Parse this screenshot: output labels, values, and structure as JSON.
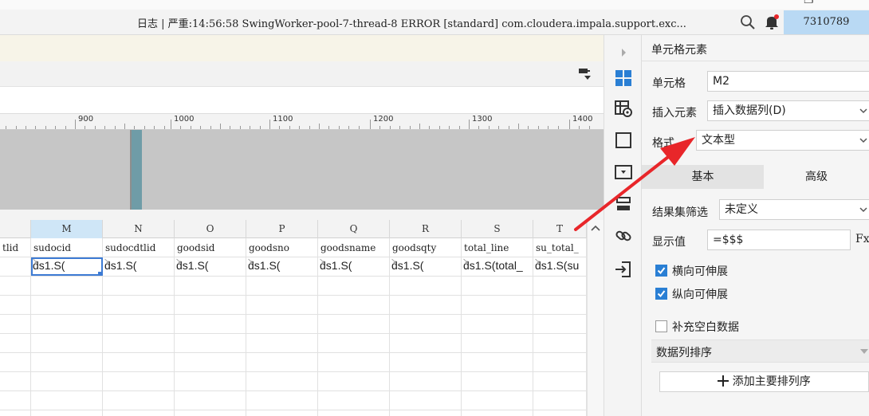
{
  "topbar": {
    "log_text": "日志 | 严重:14:56:58 SwingWorker-pool-7-thread-8 ERROR [standard] com.cloudera.impala.support.exc...",
    "user_id": "7310789",
    "restore_glyph": "❐"
  },
  "ruler": {
    "labels": [
      "900",
      "1000",
      "1100",
      "1200",
      "1300",
      "1400"
    ]
  },
  "grid": {
    "columns": [
      {
        "id": "",
        "field": "tlid",
        "expr": ""
      },
      {
        "id": "M",
        "field": "sudocid",
        "expr": "ds1.S("
      },
      {
        "id": "N",
        "field": "sudocdtlid",
        "expr": "ds1.S("
      },
      {
        "id": "O",
        "field": "goodsid",
        "expr": "ds1.S("
      },
      {
        "id": "P",
        "field": "goodsno",
        "expr": "ds1.S("
      },
      {
        "id": "Q",
        "field": "goodsname",
        "expr": "ds1.S("
      },
      {
        "id": "R",
        "field": "goodsqty",
        "expr": "ds1.S("
      },
      {
        "id": "S",
        "field": "total_line",
        "expr": "ds1.S(total_"
      },
      {
        "id": "T",
        "field": "su_total_",
        "expr": "ds1.S(su"
      }
    ],
    "selected_column": "M"
  },
  "panel": {
    "title": "单元格元素",
    "cell_label": "单元格",
    "cell_value": "M2",
    "insert_label": "插入元素",
    "insert_value": "插入数据列(D)",
    "format_label": "格式",
    "format_value": "文本型",
    "tab_basic": "基本",
    "tab_advanced": "高级",
    "filter_label": "结果集筛选",
    "filter_value": "未定义",
    "display_label": "显示值",
    "display_value": "=$$$",
    "display_fx": "Fx",
    "horizontal_expand": "横向可伸展",
    "horizontal_expand_checked": true,
    "vertical_expand": "纵向可伸展",
    "vertical_expand_checked": true,
    "fill_blank": "补充空白数据",
    "fill_blank_checked": false,
    "sort_label": "数据列排序",
    "add_sort_button": "添加主要排列序"
  },
  "icons": {
    "search": "search-icon",
    "bell": "bell-icon",
    "format_painter": "format-painter-icon",
    "side": [
      "collapse-arrow-icon",
      "cell-element-icon",
      "cell-attribute-icon",
      "widget-icon",
      "dropdown-widget-icon",
      "condition-icon",
      "hyperlink-icon",
      "import-icon"
    ]
  },
  "colors": {
    "selected_header": "#cfe6f7",
    "active_cell": "#3d7bd4",
    "checkbox": "#2a7fd4",
    "annotation_arrow": "#e8262a",
    "notification_dot": "#e8262a"
  }
}
